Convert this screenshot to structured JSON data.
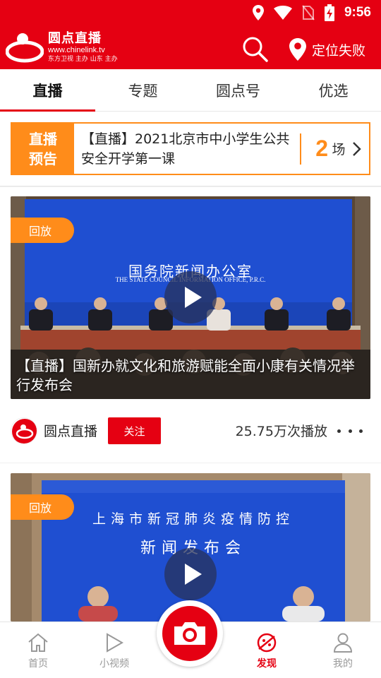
{
  "status_bar": {
    "time": "9:56",
    "icons": [
      "location-icon",
      "wifi-icon",
      "no-sim-icon",
      "battery-charging-icon"
    ]
  },
  "app_bar": {
    "logo": {
      "title": "圆点直播",
      "url": "www.chinelink.tv",
      "sub": "东方卫视 主办    山东 主办"
    },
    "search_icon": "search-icon",
    "location_label": "定位失败"
  },
  "tabs": [
    {
      "label": "直播",
      "active": true
    },
    {
      "label": "专题",
      "active": false
    },
    {
      "label": "圆点号",
      "active": false
    },
    {
      "label": "优选",
      "active": false
    }
  ],
  "live_preview": {
    "badge_line1": "直播",
    "badge_line2": "预告",
    "text": "【直播】2021北京市中小学生公共安全开学第一课",
    "count": "2",
    "unit": "场"
  },
  "cards": [
    {
      "tag": "回放",
      "banner_line1": "国务院新闻办公室",
      "banner_line2": "THE STATE COUNCIL INFORMATION OFFICE, P.R.C.",
      "caption": "【直播】国新办就文化和旅游赋能全面小康有关情况举行发布会",
      "channel": "圆点直播",
      "follow_label": "关注",
      "views": "25.75万次播放"
    },
    {
      "tag": "回放",
      "banner_line1": "上海市新冠肺炎疫情防控",
      "banner_line2": "新闻发布会"
    }
  ],
  "bottom_nav": [
    {
      "label": "首页",
      "icon": "home-icon",
      "active": false
    },
    {
      "label": "小视频",
      "icon": "play-outline-icon",
      "active": false
    },
    {
      "label": "发现",
      "icon": "discover-icon",
      "active": true
    },
    {
      "label": "我的",
      "icon": "user-icon",
      "active": false
    }
  ],
  "colors": {
    "brand_red": "#e50012",
    "accent_orange": "#ff8c1a",
    "stage_blue": "#1f4fd1"
  }
}
